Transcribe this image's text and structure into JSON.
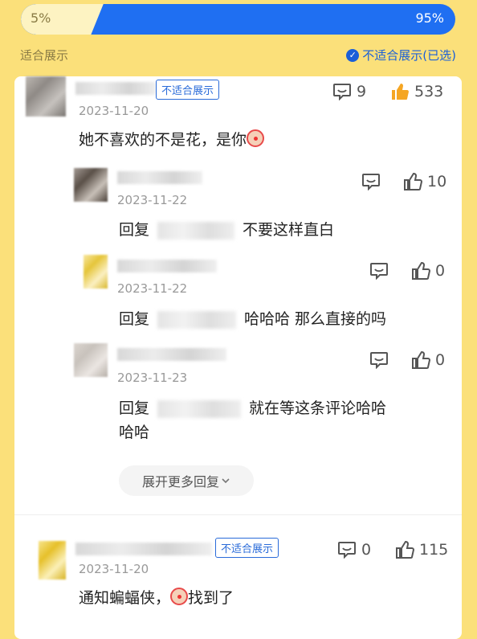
{
  "vote": {
    "left_pct": "5%",
    "right_pct": "95%",
    "left_fraction": 0.05
  },
  "labels": {
    "left": "适合展示",
    "right": "不适合展示(已选)"
  },
  "comments": [
    {
      "badge": "不适合展示",
      "date": "2023-11-20",
      "text": "她不喜欢的不是花，是你",
      "reply_count": "9",
      "like_count": "533"
    },
    {
      "badge": "不适合展示",
      "date": "2023-11-20",
      "text_before": "通知蝙蝠侠，",
      "text_after": "找到了",
      "reply_count": "0",
      "like_count": "115"
    }
  ],
  "replies": [
    {
      "date": "2023-11-22",
      "prefix": "回复",
      "text": "不要这样直白",
      "like_count": "10"
    },
    {
      "date": "2023-11-22",
      "prefix": "回复",
      "text": "哈哈哈 那么直接的吗",
      "like_count": "0"
    },
    {
      "date": "2023-11-23",
      "prefix": "回复",
      "text": "就在等这条评论哈哈",
      "text_line2": "哈哈",
      "like_count": "0"
    }
  ],
  "expand": {
    "label": "展开更多回复"
  },
  "icons": [
    "check-circle-icon",
    "comment-icon",
    "thumbs-up-filled-icon",
    "thumbs-up-icon",
    "chevron-down-icon",
    "clown-emoji-icon"
  ],
  "colors": {
    "accent": "#1f6ff2",
    "background": "#fbe07a",
    "like_active": "#f5a623"
  }
}
